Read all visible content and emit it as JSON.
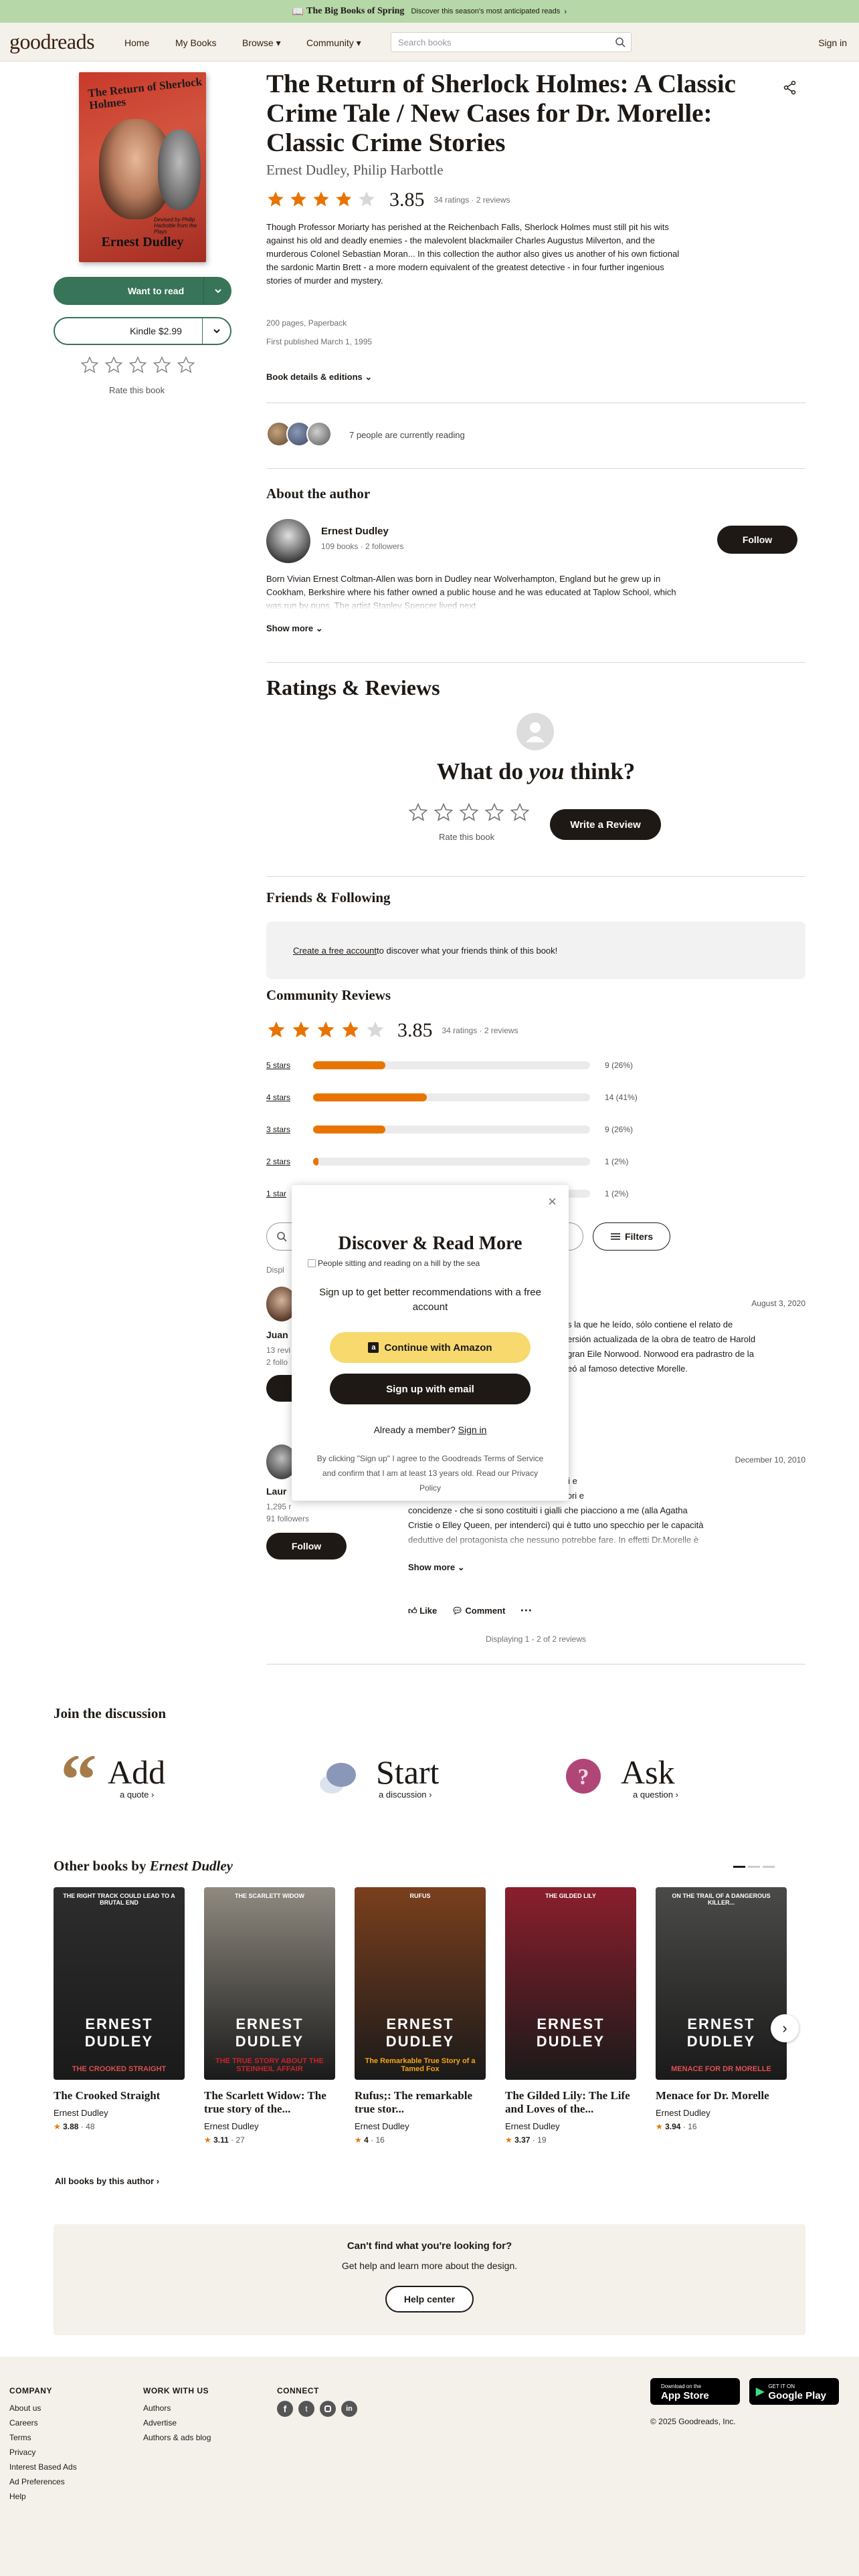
{
  "banner": {
    "title": "The Big Books of Spring",
    "sub": "Discover this season's most anticipated reads"
  },
  "nav": {
    "logo": "goodreads",
    "links": [
      "Home",
      "My Books",
      "Browse ▾",
      "Community ▾"
    ],
    "search_placeholder": "Search books",
    "signin": "Sign in"
  },
  "book": {
    "cover_title": "The Return of Sherlock Holmes",
    "cover_sub": "Devised by Philip Harbottle from the Plays",
    "cover_author": "Ernest Dudley",
    "title": "The Return of Sherlock Holmes: A Classic Crime Tale / New Cases for Dr. Morelle: Classic Crime Stories",
    "authors": "Ernest Dudley, Philip Harbottle",
    "rating": "3.85",
    "rating_fraction": 0.77,
    "ratings_count": "34 ratings · 2 reviews",
    "description": "Though Professor Moriarty has perished at the Reichenbach Falls, Sherlock Holmes must still pit his wits against his old and deadly enemies - the malevolent blackmailer Charles Augustus Milverton, and the murderous Colonel Sebastian Moran... In this collection the author also gives us another of his own fictional the sardonic Martin Brett - a more modern equivalent of the greatest detective - in four further ingenious stories of murder and mystery.",
    "format": "200 pages, Paperback",
    "published": "First published March 1, 1995",
    "details_link": "Book details & editions",
    "reading_now": "7 people are currently reading"
  },
  "actions": {
    "want_to_read": "Want to read",
    "kindle": "Kindle $2.99",
    "rate_label": "Rate this book"
  },
  "author": {
    "section_title": "About the author",
    "name": "Ernest Dudley",
    "stats": "109 books · 2 followers",
    "follow": "Follow",
    "bio": "Born Vivian Ernest Coltman-Allen was born in Dudley near Wolverhampton, England but he grew up in Cookham, Berkshire where his father owned a public house and he was educated at Taplow School, which was run by nuns. The artist Stanley Spencer lived next",
    "show_more": "Show more"
  },
  "reviews_header": {
    "title": "Ratings & Reviews",
    "what_prefix": "What do ",
    "what_em": "you",
    "what_suffix": " think?",
    "rate_label": "Rate this book",
    "write_review": "Write a Review"
  },
  "friends": {
    "title": "Friends & Following",
    "link": "Create a free account",
    "text": " to discover what your friends think of this book!"
  },
  "community": {
    "title": "Community Reviews",
    "rating": "3.85",
    "count": "34 ratings · 2 reviews",
    "bars": [
      {
        "label": "5 stars",
        "value": "9 (26%)",
        "pct": 26
      },
      {
        "label": "4 stars",
        "value": "14 (41%)",
        "pct": 41
      },
      {
        "label": "3 stars",
        "value": "9 (26%)",
        "pct": 26
      },
      {
        "label": "2 stars",
        "value": "1 (2%)",
        "pct": 2
      },
      {
        "label": "1 star",
        "value": "1 (2%)",
        "pct": 2
      }
    ],
    "filters": "Filters",
    "displaying_partial": "Displ",
    "review1": {
      "name_partial": "Juan",
      "stats_partial": "13 revi",
      "followers_partial": "2 follo",
      "date": "August 3, 2020",
      "text": "s la que he leído, sólo contiene el relato de\nersión actualizada de la obra de teatro de Harold\ngran Eile Norwood. Norwood era padrastro de la\neó al famoso detective Morelle."
    },
    "review2": {
      "name_partial": "Laur",
      "stats_partial": "1,295 r",
      "followers": "91 followers",
      "follow": "Follow",
      "date": "December 10, 2010",
      "text": "i gialli di Conan Doyle; ho voluto riprovarci e\nche un intreccio di motivazioni, azioni, errori e\nconcidenze - che si sono costituiti i gialli che piacciono a me (alla Agatha\nCristie o Elley Queen, per intenderci) qui è tutto uno specchio per le capacità\ndeduttive del protagonista che nessuno potrebbe fare. In effetti Dr.Morelle è",
      "show_more": "Show more",
      "like": "Like",
      "comment": "Comment"
    },
    "displaying": "Displaying 1 - 2 of 2 reviews"
  },
  "modal": {
    "title": "Discover & Read More",
    "img_alt": "People sitting and reading on a hill by the sea",
    "subtitle": "Sign up to get better recommendations with a free account",
    "amazon": "Continue with Amazon",
    "email": "Sign up with email",
    "member": "Already a member? ",
    "signin": "Sign in",
    "terms": "By clicking \"Sign up\" I agree to the Goodreads Terms of Service and confirm that I am at least 13 years old. Read our Privacy Policy"
  },
  "discussion": {
    "title": "Join the discussion",
    "items": [
      {
        "big": "Add",
        "small": "a quote"
      },
      {
        "big": "Start",
        "small": "a discussion"
      },
      {
        "big": "Ask",
        "small": "a question"
      }
    ]
  },
  "other_books": {
    "title_prefix": "Other books by ",
    "title_author": "Ernest Dudley",
    "books": [
      {
        "title": "The Crooked Straight",
        "author": "Ernest Dudley",
        "rating": "3.88",
        "count": "48",
        "cover_top": "THE RIGHT TRACK COULD LEAD TO A BRUTAL END",
        "cover_name": "ERNEST DUDLEY",
        "cover_sub": "THE CROOKED STRAIGHT",
        "bg": "#2d2d2d",
        "accent": "#d94f4f"
      },
      {
        "title": "The Scarlett Widow: The true story of the...",
        "author": "Ernest Dudley",
        "rating": "3.11",
        "count": "27",
        "cover_top": "THE SCARLETT WIDOW",
        "cover_name": "ERNEST DUDLEY",
        "cover_sub": "THE TRUE STORY ABOUT THE STEINHEIL AFFAIR",
        "bg": "#8f8a80",
        "accent": "#c8242a"
      },
      {
        "title": "Rufus;: The remarkable true stor...",
        "author": "Ernest Dudley",
        "rating": "4",
        "count": "16",
        "cover_top": "RUFUS",
        "cover_name": "ERNEST DUDLEY",
        "cover_sub": "The Remarkable True Story of a Tamed Fox",
        "bg": "#7a3f1d",
        "accent": "#f2a51a"
      },
      {
        "title": "The Gilded Lily: The Life and Loves of the...",
        "author": "Ernest Dudley",
        "rating": "3.37",
        "count": "19",
        "cover_top": "THE GILDED LILY",
        "cover_name": "ERNEST DUDLEY",
        "cover_sub": "",
        "bg": "#8b1e2d",
        "accent": "#ffffff"
      },
      {
        "title": "Menace for Dr. Morelle",
        "author": "Ernest Dudley",
        "rating": "3.94",
        "count": "16",
        "cover_top": "ON THE TRAIL OF A DANGEROUS KILLER...",
        "cover_name": "ERNEST DUDLEY",
        "cover_sub": "MENACE FOR DR MORELLE",
        "bg": "#4a4a48",
        "accent": "#e05050"
      }
    ],
    "all_link": "All books by this author"
  },
  "help": {
    "title": "Can't find what you're looking for?",
    "text": "Get help and learn more about the design.",
    "button": "Help center"
  },
  "footer": {
    "company": {
      "head": "COMPANY",
      "links": [
        "About us",
        "Careers",
        "Terms",
        "Privacy",
        "Interest Based Ads",
        "Ad Preferences",
        "Help"
      ]
    },
    "work": {
      "head": "WORK WITH US",
      "links": [
        "Authors",
        "Advertise",
        "Authors & ads blog"
      ]
    },
    "connect": {
      "head": "CONNECT",
      "icons": [
        "facebook-icon",
        "twitter-icon",
        "instagram-icon",
        "linkedin-icon"
      ]
    },
    "appstore_small": "Download on the",
    "appstore": "App Store",
    "play_small": "GET IT ON",
    "play": "Google Play",
    "copyright": "© 2025 Goodreads, Inc."
  },
  "colors": {
    "green": "#377458",
    "star": "#e87400",
    "nav_bg": "#f4f1ea",
    "banner_bg": "#b6d7a8",
    "dark": "#1e1915"
  }
}
